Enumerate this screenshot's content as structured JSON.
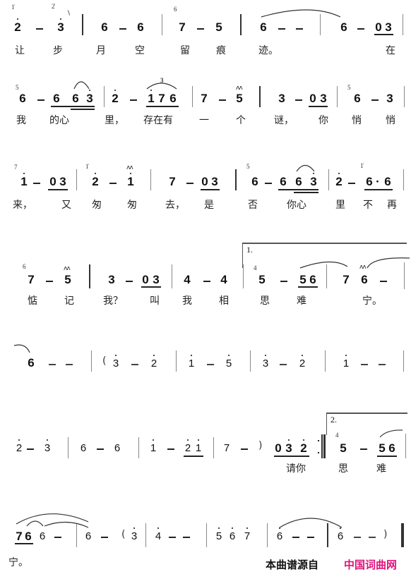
{
  "document": {
    "type": "numbered musical notation (jianpu) score",
    "accent_color": "#e0137c"
  },
  "systems": [
    {
      "measures": [
        [
          "2̇ (grace 1̇)",
          "-",
          "3̇ (grace 2̇)"
        ],
        [
          "6",
          "-",
          "6"
        ],
        [
          "7 (grace 6)",
          "-",
          "5"
        ],
        [
          "6",
          "-",
          "-"
        ],
        [
          "6",
          "-",
          "0 3"
        ]
      ],
      "lyrics": [
        "让",
        "步",
        "月",
        "空",
        "留",
        "痕",
        "迹。",
        "在"
      ]
    },
    {
      "measures": [
        [
          "6 (grace 5)",
          "-",
          "6 6 3̇"
        ],
        [
          "2̇",
          "-",
          "1̇ 7 6 (triplet 3)"
        ],
        [
          "7",
          "-",
          "5 (mordent)"
        ],
        [
          "3",
          "-",
          "0 3"
        ],
        [
          "6 (grace 5)",
          "-",
          "3"
        ]
      ],
      "lyrics": [
        "我",
        "的心",
        "里，",
        "存在有",
        "一",
        "个",
        "谜，",
        "你",
        "悄",
        "悄"
      ]
    },
    {
      "measures": [
        [
          "1̇ (grace 7)",
          "-",
          "0 3"
        ],
        [
          "2̇ (grace 1̇)",
          "-",
          "1̇ (mordent)"
        ],
        [
          "7",
          "-",
          "0 3"
        ],
        [
          "6 (grace 5)",
          "-",
          "6 6 3̇"
        ],
        [
          "2̇",
          "-",
          "6 . 6 (grace 1̇)"
        ]
      ],
      "lyrics": [
        "来，",
        "又",
        "匆",
        "匆",
        "去，",
        "是",
        "否",
        "你心",
        "里",
        "不",
        "再"
      ]
    },
    {
      "measures": [
        [
          "7 (grace 6)",
          "-",
          "5 (mordent)"
        ],
        [
          "3",
          "-",
          "0 3"
        ],
        [
          "4",
          "-",
          "4"
        ],
        [
          "5 (grace 4)",
          "-",
          "5 6"
        ],
        [
          "7",
          "6 (mordent)",
          "-"
        ]
      ],
      "volta": "1.",
      "lyrics": [
        "惦",
        "记",
        "我？",
        "叫",
        "我",
        "相",
        "思",
        "难",
        "宁。"
      ]
    },
    {
      "measures": [
        [
          "6",
          "-",
          "-"
        ],
        [
          "(",
          "3̇",
          "-",
          "2̇"
        ],
        [
          "1̇",
          "-",
          "5"
        ],
        [
          "3̇",
          "-",
          "2̇"
        ],
        [
          "1̇",
          "-",
          "-"
        ]
      ],
      "lyrics": []
    },
    {
      "measures": [
        [
          "2̇",
          "-",
          "3̇"
        ],
        [
          "6",
          "-",
          "6"
        ],
        [
          "1̇",
          "-",
          "2̇ 1̇"
        ],
        [
          "7",
          "-",
          ")",
          "0 3̇ 2̇"
        ],
        [
          "5 (grace 4)",
          "-",
          "5 6"
        ]
      ],
      "volta": "2.",
      "lyrics": [
        "请你",
        "思",
        "难"
      ]
    },
    {
      "measures": [
        [
          "7 6",
          "6",
          "-"
        ],
        [
          "6",
          "-",
          "(",
          "3̇"
        ],
        [
          "4̇",
          "-",
          "-"
        ],
        [
          "5̇",
          "6̇",
          "7̇"
        ],
        [
          "6̇",
          "-",
          "-"
        ],
        [
          "6̇",
          "-",
          "-",
          ")"
        ]
      ],
      "lyrics": [
        "宁。"
      ]
    }
  ],
  "labels": {
    "volta1": "1.",
    "volta2": "2.",
    "triplet": "3",
    "paren_open": "(",
    "paren_close": ")",
    "footer_source": "本曲谱源自",
    "footer_site": "中国词曲网"
  },
  "glyphs": {
    "r1": {
      "a": "2",
      "b": "3",
      "c": "6",
      "d": "6",
      "e": "7",
      "f": "5",
      "g": "6",
      "h": "6",
      "i": "0",
      "j": "3",
      "gA": "1̇",
      "gB": "2̇",
      "gC": "6"
    },
    "r2": {
      "a": "6",
      "b": "6",
      "c": "6",
      "d": "3",
      "e": "2",
      "f": "1",
      "g": "7",
      "h": "6",
      "i": "7",
      "j": "5",
      "k": "3",
      "l": "0",
      "m": "3",
      "n": "6",
      "o": "3",
      "gA": "5",
      "gB": "5"
    },
    "r3": {
      "a": "1",
      "b": "0",
      "c": "3",
      "d": "2",
      "e": "1",
      "f": "7",
      "g": "0",
      "h": "3",
      "i": "6",
      "j": "6",
      "k": "6",
      "l": "3",
      "m": "2",
      "n": "6",
      "o": "·",
      "p": "6",
      "gA": "7",
      "gB": "1̇",
      "gC": "5",
      "gD": "1̇"
    },
    "r4": {
      "a": "7",
      "b": "5",
      "c": "3",
      "d": "0",
      "e": "3",
      "f": "4",
      "g": "4",
      "h": "5",
      "i": "5",
      "j": "6",
      "k": "7",
      "l": "6",
      "gA": "6",
      "gB": "4"
    },
    "r5": {
      "a": "6",
      "b": "3",
      "c": "2",
      "d": "1",
      "e": "5",
      "f": "3",
      "g": "2",
      "h": "1"
    },
    "r6": {
      "a": "2",
      "b": "3",
      "c": "6",
      "d": "6",
      "e": "1",
      "f": "2",
      "g": "1",
      "h": "7",
      "i": "0",
      "j": "3",
      "k": "2",
      "l": "5",
      "m": "5",
      "n": "6",
      "gA": "4"
    },
    "r7": {
      "a": "7",
      "b": "6",
      "c": "6",
      "d": "6",
      "e": "3",
      "f": "4",
      "g": "5",
      "h": "6",
      "i": "7",
      "j": "6",
      "k": "6"
    },
    "mordent": "ʌʌ"
  }
}
